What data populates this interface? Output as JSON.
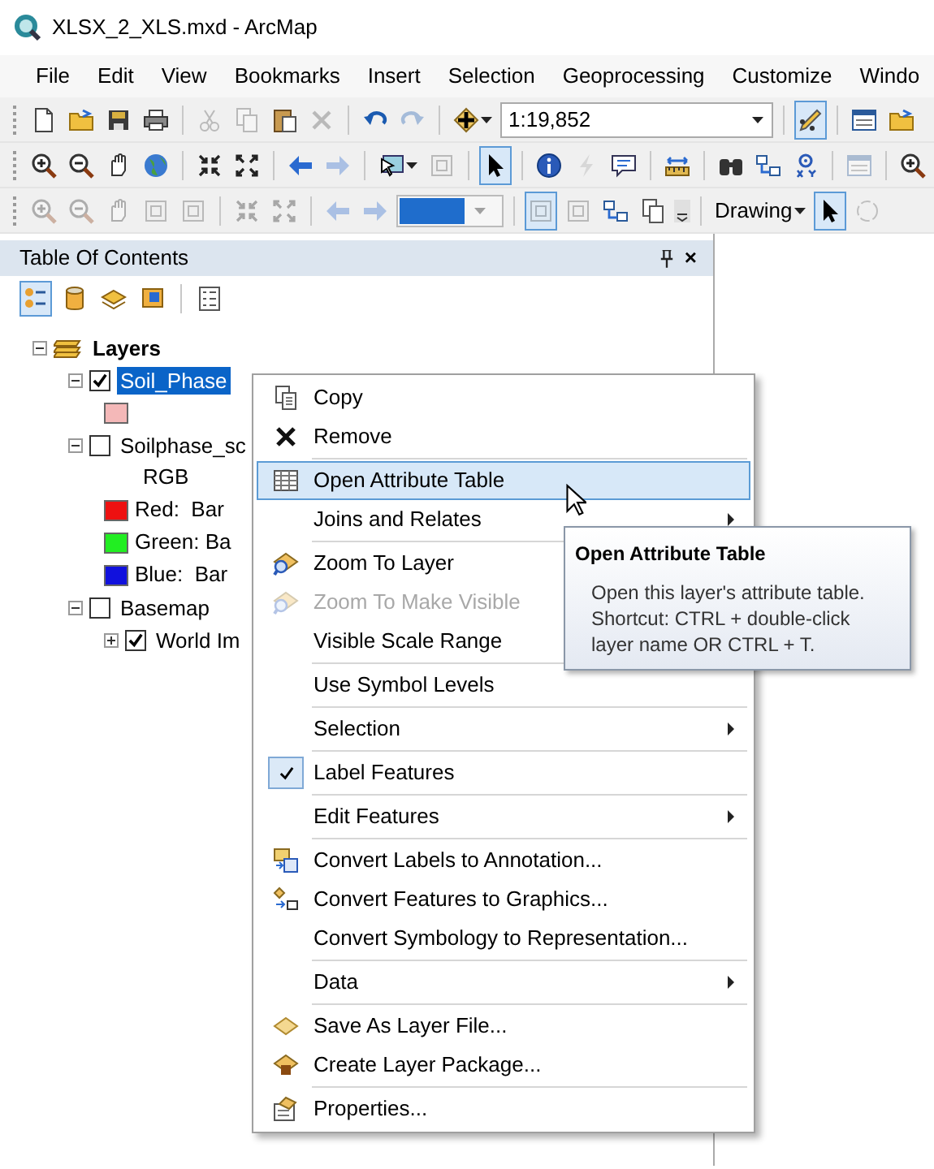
{
  "window": {
    "title": "XLSX_2_XLS.mxd - ArcMap"
  },
  "menubar": [
    "File",
    "Edit",
    "View",
    "Bookmarks",
    "Insert",
    "Selection",
    "Geoprocessing",
    "Customize",
    "Windo"
  ],
  "toolbars": [
    [
      {
        "kind": "document",
        "disabled": false
      },
      {
        "kind": "folder",
        "disabled": false
      },
      {
        "kind": "disk",
        "disabled": false
      },
      {
        "kind": "printer",
        "disabled": false
      },
      {
        "kind": "sep"
      },
      {
        "kind": "scissors",
        "disabled": true
      },
      {
        "kind": "pages",
        "disabled": true
      },
      {
        "kind": "clipboard",
        "disabled": false
      },
      {
        "kind": "cross",
        "disabled": true
      },
      {
        "kind": "sep"
      },
      {
        "kind": "undo",
        "disabled": false
      },
      {
        "kind": "redo",
        "disabled": true
      },
      {
        "kind": "sep"
      },
      {
        "kind": "plus",
        "disabled": false,
        "menu": true
      },
      {
        "kind": "scale",
        "value": "1:19,852"
      },
      {
        "kind": "sep"
      },
      {
        "kind": "pencil",
        "disabled": false,
        "pressed": true
      },
      {
        "kind": "sep"
      },
      {
        "kind": "window",
        "disabled": false
      },
      {
        "kind": "folder",
        "disabled": false
      }
    ],
    [
      {
        "kind": "zoomin",
        "disabled": false
      },
      {
        "kind": "zoomout",
        "disabled": false
      },
      {
        "kind": "hand",
        "disabled": false
      },
      {
        "kind": "globe",
        "disabled": false
      },
      {
        "kind": "sep"
      },
      {
        "kind": "shrink",
        "disabled": false
      },
      {
        "kind": "expand",
        "disabled": false
      },
      {
        "kind": "sep"
      },
      {
        "kind": "left",
        "disabled": false
      },
      {
        "kind": "right",
        "disabled": true
      },
      {
        "kind": "sep"
      },
      {
        "kind": "mapselect",
        "disabled": false,
        "menu": true
      },
      {
        "kind": "frame",
        "disabled": true
      },
      {
        "kind": "sep"
      },
      {
        "kind": "pointer",
        "disabled": false,
        "pressed": true
      },
      {
        "kind": "sep"
      },
      {
        "kind": "info",
        "disabled": false
      },
      {
        "kind": "bolt",
        "disabled": true
      },
      {
        "kind": "balloon",
        "disabled": false
      },
      {
        "kind": "sep"
      },
      {
        "kind": "ruler",
        "disabled": false
      },
      {
        "kind": "sep"
      },
      {
        "kind": "binoculars",
        "disabled": false
      },
      {
        "kind": "boxes",
        "disabled": false
      },
      {
        "kind": "target",
        "disabled": false
      },
      {
        "kind": "sep"
      },
      {
        "kind": "window",
        "disabled": true
      },
      {
        "kind": "sep"
      },
      {
        "kind": "zoomin",
        "disabled": false
      }
    ],
    [
      {
        "kind": "zoomin",
        "disabled": true
      },
      {
        "kind": "zoomout",
        "disabled": true
      },
      {
        "kind": "hand",
        "disabled": true
      },
      {
        "kind": "frame",
        "disabled": true
      },
      {
        "kind": "frame",
        "disabled": true
      },
      {
        "kind": "sep"
      },
      {
        "kind": "shrink",
        "disabled": true
      },
      {
        "kind": "expand",
        "disabled": true
      },
      {
        "kind": "sep"
      },
      {
        "kind": "left",
        "disabled": true
      },
      {
        "kind": "right",
        "disabled": true
      },
      {
        "kind": "colorbox",
        "disabled": true
      },
      {
        "kind": "sep"
      },
      {
        "kind": "frame",
        "disabled": true,
        "pressed": true
      },
      {
        "kind": "frame",
        "disabled": true
      },
      {
        "kind": "boxes",
        "disabled": false
      },
      {
        "kind": "pages",
        "disabled": false
      },
      {
        "kind": "more"
      },
      {
        "kind": "sep"
      },
      {
        "kind": "label",
        "label": "Drawing",
        "menu": true
      },
      {
        "kind": "pointer",
        "disabled": false,
        "pressed": true
      },
      {
        "kind": "circle",
        "disabled": true
      }
    ]
  ],
  "toc": {
    "title": "Table Of Contents",
    "close": "×",
    "tools": [
      {
        "kind": "drawing",
        "selected": true
      },
      {
        "kind": "source",
        "selected": false
      },
      {
        "kind": "visibility",
        "selected": false
      },
      {
        "kind": "selection",
        "selected": false
      },
      {
        "kind": "options",
        "selected": false
      }
    ],
    "tree": [
      {
        "kind": "group",
        "label": "Layers",
        "expanded": true,
        "selected": false,
        "children": [
          {
            "kind": "layer",
            "label": "Soil_Phase",
            "expanded": true,
            "checked": true,
            "selected": true,
            "children": [
              {
                "kind": "swatch",
                "color": "#f4b8b8"
              }
            ]
          },
          {
            "kind": "layer",
            "label": "Soilphase_sc",
            "expanded": true,
            "checked": false,
            "selected": false,
            "children": [
              {
                "kind": "text",
                "label": "RGB"
              },
              {
                "kind": "swatch",
                "color": "#ee1111",
                "label": "Red:  Bar"
              },
              {
                "kind": "swatch",
                "color": "#22ee22",
                "label": "Green: Ba"
              },
              {
                "kind": "swatch",
                "color": "#1111dd",
                "label": "Blue:  Bar"
              }
            ]
          },
          {
            "kind": "layer",
            "label": "Basemap",
            "expanded": true,
            "checked": false,
            "selected": false,
            "children": [
              {
                "kind": "layer",
                "label": "World Im",
                "expanded": false,
                "checked": true,
                "selected": false
              }
            ]
          }
        ]
      }
    ]
  },
  "context_menu": [
    {
      "kind": "copy",
      "label": "Copy",
      "disabled": false,
      "selected": false
    },
    {
      "kind": "remove",
      "label": "Remove",
      "disabled": false,
      "selected": false
    },
    {
      "kind": "sep"
    },
    {
      "kind": "table",
      "label": "Open Attribute Table",
      "disabled": false,
      "selected": true
    },
    {
      "kind": "item",
      "label": "Joins and Relates",
      "submenu": true,
      "disabled": false,
      "selected": false
    },
    {
      "kind": "sep"
    },
    {
      "kind": "zoom",
      "label": "Zoom To Layer",
      "disabled": false,
      "selected": false
    },
    {
      "kind": "zoom",
      "label": "Zoom To Make Visible",
      "disabled": true,
      "selected": false
    },
    {
      "kind": "item",
      "label": "Visible Scale Range",
      "disabled": false,
      "selected": false
    },
    {
      "kind": "sep"
    },
    {
      "kind": "item",
      "label": "Use Symbol Levels",
      "disabled": false,
      "selected": false
    },
    {
      "kind": "sep"
    },
    {
      "kind": "item",
      "label": "Selection",
      "submenu": true,
      "disabled": false,
      "selected": false
    },
    {
      "kind": "sep"
    },
    {
      "kind": "item",
      "label": "Label Features",
      "checked": true,
      "disabled": false,
      "selected": false
    },
    {
      "kind": "sep"
    },
    {
      "kind": "item",
      "label": "Edit Features",
      "submenu": true,
      "disabled": false,
      "selected": false
    },
    {
      "kind": "sep"
    },
    {
      "kind": "annotation",
      "label": "Convert Labels to Annotation...",
      "disabled": false,
      "selected": false
    },
    {
      "kind": "graphics",
      "label": "Convert Features to Graphics...",
      "disabled": false,
      "selected": false
    },
    {
      "kind": "item",
      "label": "Convert Symbology to Representation...",
      "disabled": false,
      "selected": false
    },
    {
      "kind": "sep"
    },
    {
      "kind": "item",
      "label": "Data",
      "submenu": true,
      "disabled": false,
      "selected": false
    },
    {
      "kind": "sep"
    },
    {
      "kind": "layerfile",
      "label": "Save As Layer File...",
      "disabled": false,
      "selected": false
    },
    {
      "kind": "package",
      "label": "Create Layer Package...",
      "disabled": false,
      "selected": false
    },
    {
      "kind": "sep"
    },
    {
      "kind": "properties",
      "label": "Properties...",
      "disabled": false,
      "selected": false
    }
  ],
  "tooltip": {
    "title": "Open Attribute Table",
    "lines": [
      "Open this layer's attribute table.",
      "Shortcut: CTRL + double-click",
      "layer name OR CTRL + T."
    ]
  }
}
